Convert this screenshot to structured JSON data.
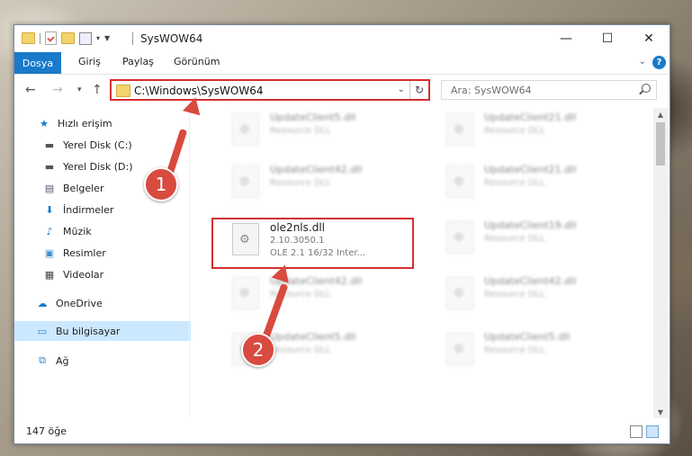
{
  "window": {
    "title": "SysWOW64",
    "controls": {
      "minimize": "—",
      "maximize": "☐",
      "close": "✕"
    }
  },
  "ribbon": {
    "file_tab": "Dosya",
    "tabs": [
      "Giriş",
      "Paylaş",
      "Görünüm"
    ],
    "help": "?"
  },
  "navigation": {
    "address": "C:\\Windows\\SysWOW64",
    "search_placeholder": "Ara: SysWOW64"
  },
  "sidebar": {
    "items": [
      {
        "label": "Hızlı erişim",
        "icon": "star-icon",
        "pinned": false
      },
      {
        "label": "Yerel Disk (C:)",
        "icon": "drive-icon",
        "pinned": false
      },
      {
        "label": "Yerel Disk (D:)",
        "icon": "drive-icon",
        "pinned": true
      },
      {
        "label": "Belgeler",
        "icon": "documents-icon",
        "pinned": true
      },
      {
        "label": "İndirmeler",
        "icon": "download-icon",
        "pinned": true
      },
      {
        "label": "Müzik",
        "icon": "music-icon",
        "pinned": true
      },
      {
        "label": "Resimler",
        "icon": "pictures-icon",
        "pinned": true
      },
      {
        "label": "Videolar",
        "icon": "videos-icon",
        "pinned": true
      },
      {
        "label": "OneDrive",
        "icon": "cloud-icon",
        "pinned": false
      },
      {
        "label": "Bu bilgisayar",
        "icon": "computer-icon",
        "pinned": false,
        "selected": true
      },
      {
        "label": "Ağ",
        "icon": "network-icon",
        "pinned": false
      }
    ]
  },
  "files": {
    "left": [
      {
        "name": "UpdateClient5.dll",
        "desc": "Resource DLL"
      },
      {
        "name": "UpdateClient42.dll",
        "desc": "Resource DLL"
      },
      {
        "name": "ole2nls.dll",
        "desc": "2.10.3050.1",
        "extra": "OLE 2.1 16/32 Inter..."
      },
      {
        "name": "UpdateClient42.dll",
        "desc": "Resource DLL"
      },
      {
        "name": "UpdateClient5.dll",
        "desc": "Resource DLL"
      }
    ],
    "right": [
      {
        "name": "UpdateClient21.dll",
        "desc": "Resource DLL"
      },
      {
        "name": "UpdateClient21.dll",
        "desc": "Resource DLL"
      },
      {
        "name": "UpdateClient19.dll",
        "desc": "Resource DLL"
      },
      {
        "name": "UpdateClient42.dll",
        "desc": "Resource DLL"
      },
      {
        "name": "UpdateClient5.dll",
        "desc": "Resource DLL"
      }
    ]
  },
  "status": {
    "count": "147 öğe"
  },
  "annotations": {
    "step1": "1",
    "step2": "2"
  },
  "colors": {
    "accent": "#1979ca",
    "highlight": "#d32f2f",
    "badge": "#d94a3f"
  }
}
